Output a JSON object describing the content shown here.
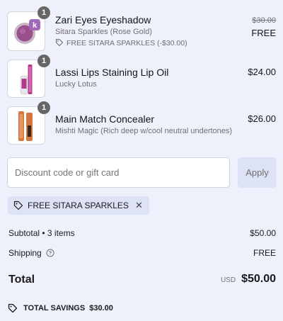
{
  "items": [
    {
      "name": "Zari Eyes Eyeshadow",
      "variant": "Sitara Sparkles (Rose Gold)",
      "discount": "FREE SITARA SPARKLES (-$30.00)",
      "compare_price": "$30.00",
      "price": "FREE",
      "quantity": "1",
      "image_icon": "eyeshadow-compact-icon"
    },
    {
      "name": "Lassi Lips Staining Lip Oil",
      "variant": "Lucky Lotus",
      "price": "$24.00",
      "quantity": "1",
      "image_icon": "lip-oil-tube-icon"
    },
    {
      "name": "Main Match Concealer",
      "variant": "Mishti Magic (Rich deep w/cool neutral undertones)",
      "price": "$26.00",
      "quantity": "1",
      "image_icon": "concealer-tube-icon"
    }
  ],
  "discount_form": {
    "placeholder": "Discount code or gift card",
    "apply_label": "Apply"
  },
  "applied_code": {
    "label": "FREE SITARA SPARKLES",
    "remove_symbol": "✕"
  },
  "summary": {
    "subtotal_label": "Subtotal • 3 items",
    "subtotal_value": "$50.00",
    "shipping_label": "Shipping",
    "shipping_value": "FREE",
    "total_label": "Total",
    "currency": "USD",
    "total_value": "$50.00",
    "savings_label": "TOTAL SAVINGS",
    "savings_value": "$30.00"
  },
  "colors": {
    "page_background": "#eef0fb",
    "apply_button": "#dde2f6",
    "chip_background": "#dde2f5",
    "quantity_badge": "#666666",
    "eyeshadow_compact": "#9a4f8c",
    "brand_mark": "#a06ab8",
    "lip_oil": "#b23a8a",
    "concealer": "#d5773c"
  }
}
